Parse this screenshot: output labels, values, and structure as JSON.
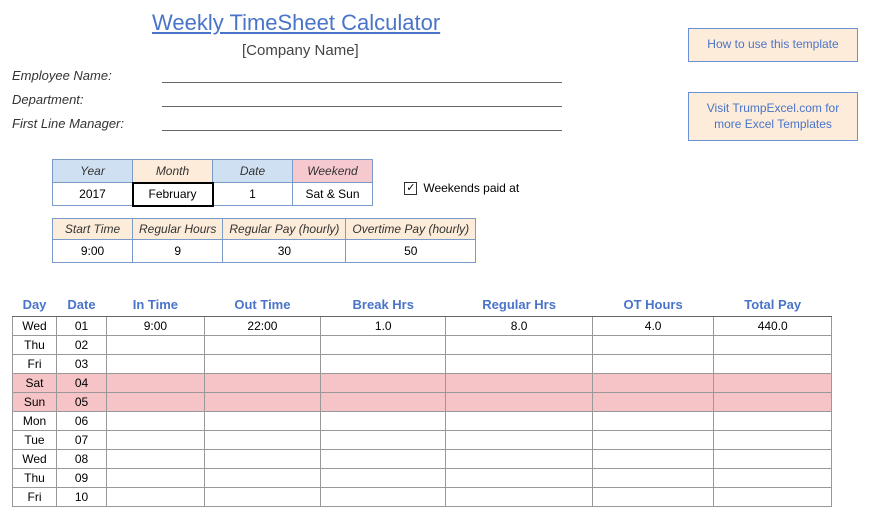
{
  "title": "Weekly TimeSheet Calculator",
  "company": "[Company Name]",
  "sideButtons": {
    "howto": "How to use this template",
    "visit": "Visit TrumpExcel.com for more Excel Templates"
  },
  "formLabels": {
    "employee": "Employee Name:",
    "department": "Department:",
    "manager": "First Line Manager:"
  },
  "dateParams": {
    "headers": {
      "year": "Year",
      "month": "Month",
      "date": "Date",
      "weekend": "Weekend"
    },
    "values": {
      "year": "2017",
      "month": "February",
      "date": "1",
      "weekend": "Sat & Sun"
    }
  },
  "checkbox": {
    "checked": true,
    "label": "Weekends paid at"
  },
  "payParams": {
    "headers": {
      "start": "Start Time",
      "reg": "Regular Hours",
      "regpay": "Regular Pay (hourly)",
      "otpay": "Overtime Pay (hourly)"
    },
    "values": {
      "start": "9:00",
      "reg": "9",
      "regpay": "30",
      "otpay": "50"
    }
  },
  "sheetHeaders": {
    "day": "Day",
    "date": "Date",
    "in": "In Time",
    "out": "Out Time",
    "break": "Break Hrs",
    "reg": "Regular Hrs",
    "ot": "OT Hours",
    "total": "Total Pay"
  },
  "rows": [
    {
      "day": "Wed",
      "date": "01",
      "in": "9:00",
      "out": "22:00",
      "break": "1.0",
      "reg": "8.0",
      "ot": "4.0",
      "total": "440.0",
      "weekend": false
    },
    {
      "day": "Thu",
      "date": "02",
      "in": "",
      "out": "",
      "break": "",
      "reg": "",
      "ot": "",
      "total": "",
      "weekend": false
    },
    {
      "day": "Fri",
      "date": "03",
      "in": "",
      "out": "",
      "break": "",
      "reg": "",
      "ot": "",
      "total": "",
      "weekend": false
    },
    {
      "day": "Sat",
      "date": "04",
      "in": "",
      "out": "",
      "break": "",
      "reg": "",
      "ot": "",
      "total": "",
      "weekend": true
    },
    {
      "day": "Sun",
      "date": "05",
      "in": "",
      "out": "",
      "break": "",
      "reg": "",
      "ot": "",
      "total": "",
      "weekend": true
    },
    {
      "day": "Mon",
      "date": "06",
      "in": "",
      "out": "",
      "break": "",
      "reg": "",
      "ot": "",
      "total": "",
      "weekend": false
    },
    {
      "day": "Tue",
      "date": "07",
      "in": "",
      "out": "",
      "break": "",
      "reg": "",
      "ot": "",
      "total": "",
      "weekend": false
    },
    {
      "day": "Wed",
      "date": "08",
      "in": "",
      "out": "",
      "break": "",
      "reg": "",
      "ot": "",
      "total": "",
      "weekend": false
    },
    {
      "day": "Thu",
      "date": "09",
      "in": "",
      "out": "",
      "break": "",
      "reg": "",
      "ot": "",
      "total": "",
      "weekend": false
    },
    {
      "day": "Fri",
      "date": "10",
      "in": "",
      "out": "",
      "break": "",
      "reg": "",
      "ot": "",
      "total": "",
      "weekend": false
    }
  ]
}
